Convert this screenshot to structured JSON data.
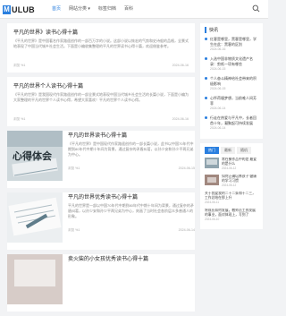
{
  "header": {
    "logo_mark": "M",
    "logo_text": "ULUB",
    "nav": [
      {
        "label": "首页"
      },
      {
        "label": "网站分类 ▾"
      },
      {
        "label": "标签归档"
      },
      {
        "label": "百科"
      }
    ]
  },
  "articles": [
    {
      "title": "平凡的世界》读书心得十篇",
      "text": "《平凡的世界》是中国著名作家路遥创作的一部百万字的小说。这部小说以恢宏的气势和史诗般的品格，全景式地表现了中国当代城乡社会生活。下面是小编收集整理的平凡的世界读书心得十篇，欢迎借鉴参考。",
      "views": "浏览 %1",
      "date": "2024-06-16"
    },
    {
      "title": "平凡的世界个人读书心得十篇",
      "text": "《平凡的世界》是我国现代作家路遥创作的一部全景式地表现中国当代城乡社会生活的长篇小说，下面是小编为大家整理的平凡的世界个人读书心得，希望大家喜欢！平凡的世界个人读书心得。",
      "views": "浏览 %1",
      "date": "2024-06-16"
    },
    {
      "title": "平凡的世界读书心得十篇",
      "text": "《平凡的世界》是中国现代作家路遥创作的一部长篇小说，此书以中国70年代中期到80年代中期十年间为背景，通过复杂的矛盾纠葛，以孙少安和孙少平两兄弟为中心。",
      "views": "浏览 %1",
      "date": "2024-06-15",
      "thumb_label": "心得体会"
    },
    {
      "title": "平凡的世界优秀读书心得十篇",
      "text": "平凡的世界是一部以中国70年代中期到80年代中期十年间为背景，通过复杂的矛盾纠葛，以孙少安和孙少平两兄弟为中心，刻画了当时社会各阶层众多普通人的形象。",
      "views": "浏览 %1",
      "date": "2024-06-14"
    },
    {
      "title": "卖火柴的小女孩优秀读书心得十篇",
      "text": "",
      "views": "",
      "date": ""
    }
  ],
  "sidebar": {
    "flash_title": "快讯",
    "flash": [
      {
        "title": "红客是哪里，黑客是哪里，学生在此：黑客的区别",
        "date": "2024-06-16"
      },
      {
        "title": "入选中国非物质文化遗产名录：剪纸一项有哪些",
        "date": "2024-06-15"
      },
      {
        "title": "个人奋斗精神给社会带来的积极影响",
        "date": "2024-06-15"
      },
      {
        "title": "心怀荷塘梦想，当前唯人间芳菲",
        "date": "2024-06-14"
      },
      {
        "title": "行走在热爱与平凡中，长者回首十年，凝聚起可持续发展",
        "date": "2024-06-14"
      }
    ],
    "tabs": [
      "热门",
      "最新",
      "随机"
    ],
    "hot": [
      {
        "title": "常在聚作品中的是 最爱的是什么",
        "date": "2024-06-12"
      },
      {
        "title": "如何正确培养孩子 健康的学习习惯",
        "date": "2024-06-12"
      }
    ],
    "lines": [
      {
        "title": "关于我爱我的二十二条和十二三，工作总结在那上升",
        "date": "2024-06-11"
      },
      {
        "title": "将成长如何发展，教师员工到发展的事业，面对体现上，写到了",
        "date": "2024-06-10"
      }
    ]
  },
  "colors": {
    "accent": "#2a7fdf"
  }
}
